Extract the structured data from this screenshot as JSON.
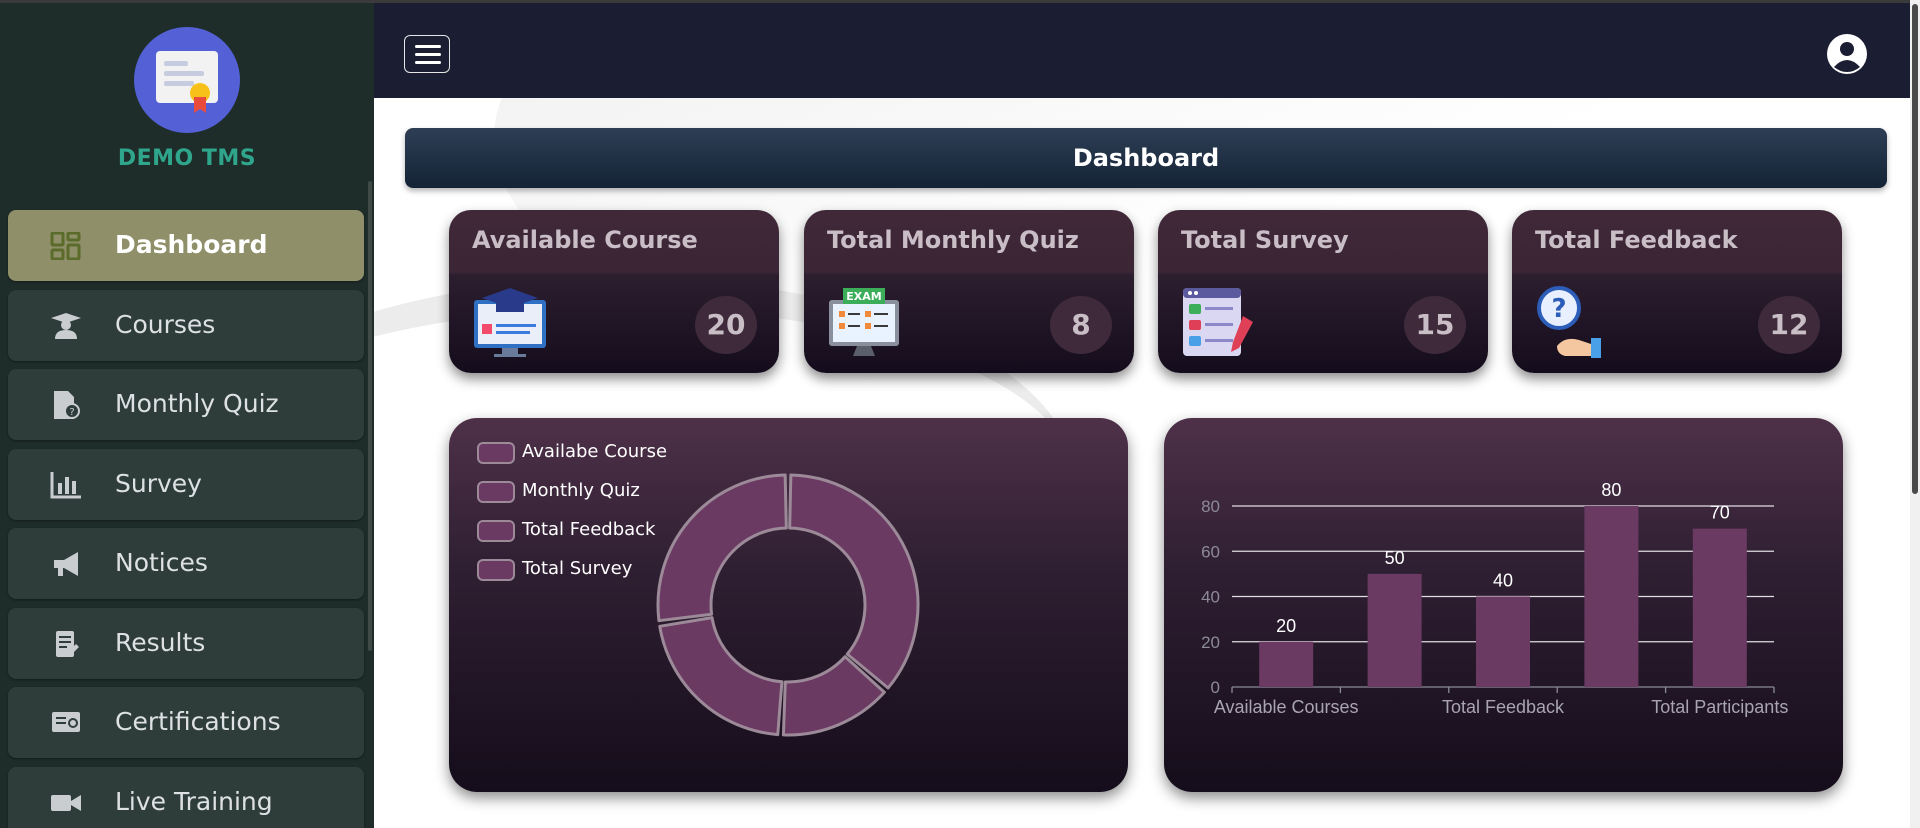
{
  "brand": {
    "name": "DEMO TMS"
  },
  "sidebar": {
    "items": [
      {
        "label": "Dashboard",
        "icon": "dashboard-icon",
        "active": true
      },
      {
        "label": "Courses",
        "icon": "graduate-icon"
      },
      {
        "label": "Monthly Quiz",
        "icon": "quiz-document-icon"
      },
      {
        "label": "Survey",
        "icon": "bar-chart-icon"
      },
      {
        "label": "Notices",
        "icon": "megaphone-icon"
      },
      {
        "label": "Results",
        "icon": "results-document-icon"
      },
      {
        "label": "Certifications",
        "icon": "certificate-icon"
      },
      {
        "label": "Live Training",
        "icon": "video-camera-icon"
      }
    ]
  },
  "header": {
    "title": "Dashboard"
  },
  "cards": [
    {
      "title": "Available Course",
      "count": "20",
      "icon": "course-screen-icon"
    },
    {
      "title": "Total Monthly Quiz",
      "count": "8",
      "icon": "exam-monitor-icon"
    },
    {
      "title": "Total Survey",
      "count": "15",
      "icon": "survey-checklist-icon"
    },
    {
      "title": "Total Feedback",
      "count": "12",
      "icon": "feedback-question-icon"
    }
  ],
  "colors": {
    "accent_active": "#8f8f6a",
    "chart_fill": "#6b3a63",
    "brand_text": "#2fa58b"
  },
  "chart_data": [
    {
      "type": "pie",
      "donut": true,
      "legend_placement": "top-left",
      "categories": [
        "Availabe Course",
        "Monthly Quiz",
        "Total Feedback",
        "Total Survey"
      ],
      "values": [
        20,
        8,
        12,
        15
      ]
    },
    {
      "type": "bar",
      "categories": [
        "Available Courses",
        "",
        "Total Feedback",
        "",
        "Total Participants"
      ],
      "values": [
        20,
        50,
        40,
        80,
        70
      ],
      "data_labels": [
        "20",
        "50",
        "40",
        "80",
        "70"
      ],
      "yticks": [
        "0",
        "20",
        "40",
        "60",
        "80"
      ],
      "ylim": [
        0,
        80
      ],
      "grid": true
    }
  ]
}
